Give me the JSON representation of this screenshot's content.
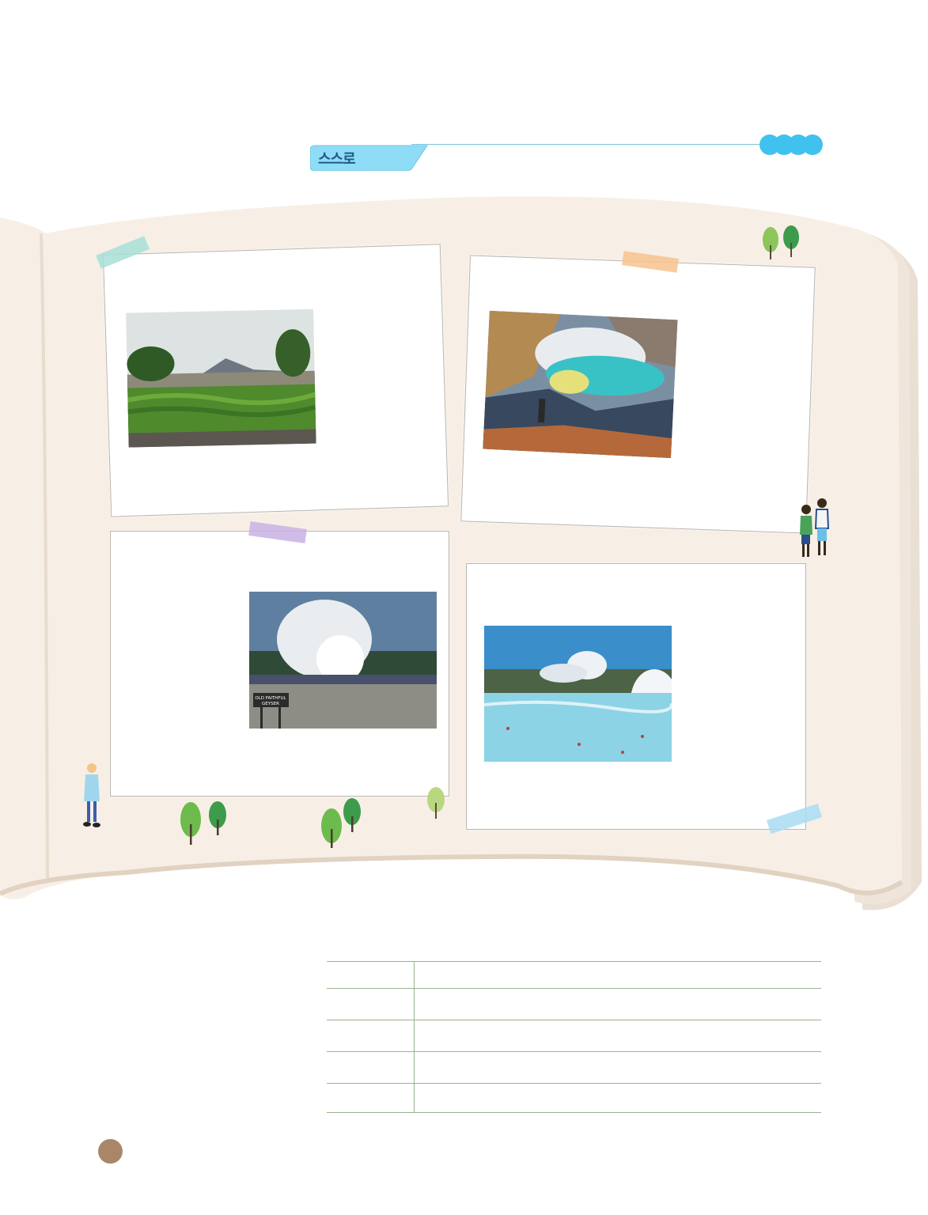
{
  "header": {
    "label": "스스로",
    "tab_color": "#8fdcf7",
    "accent_color": "#40c2ee"
  },
  "cards": [
    {
      "name": "vineyard-volcano-photo",
      "tape_color": "#a7dfd6"
    },
    {
      "name": "sulfur-crater-photo",
      "tape_color": "#f7c38e"
    },
    {
      "name": "geyser-photo",
      "tape_color": "#c8b2e3",
      "sign_text": "OLD FAITHFUL GEYSER"
    },
    {
      "name": "hot-spring-lagoon-photo",
      "tape_color": "#a9dcf3"
    }
  ],
  "table": {
    "rows": [
      {
        "label": "",
        "value": ""
      },
      {
        "label": "",
        "value": ""
      },
      {
        "label": "",
        "value": ""
      },
      {
        "label": "",
        "value": ""
      },
      {
        "label": "",
        "value": ""
      }
    ]
  },
  "page_marker_color": "#a98668"
}
